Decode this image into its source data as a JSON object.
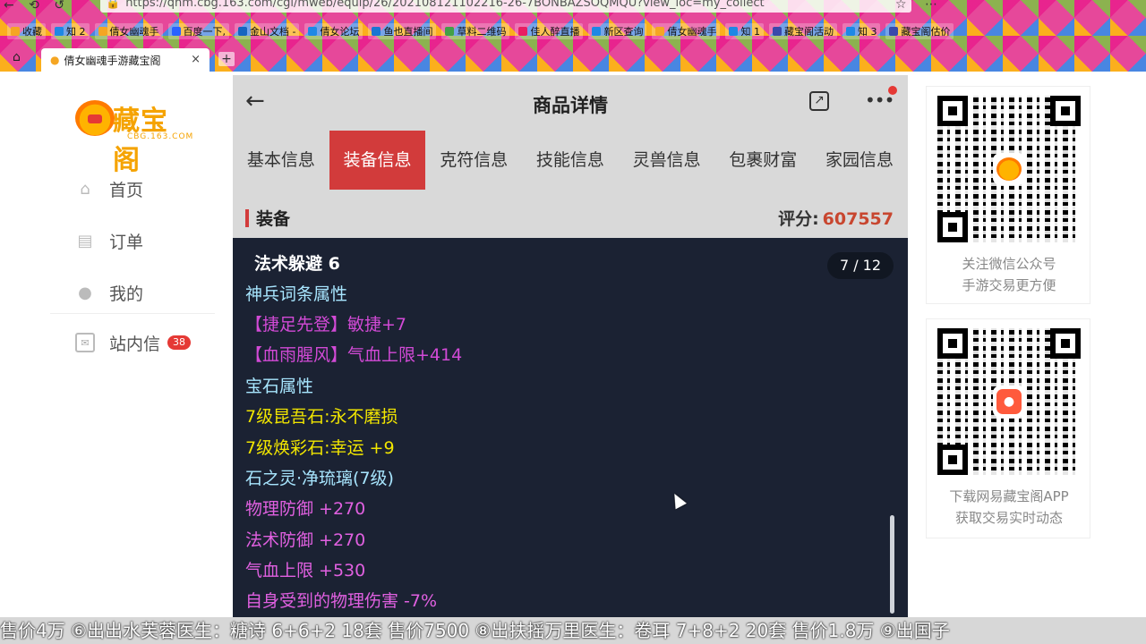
{
  "browser": {
    "url": "https://qnm.cbg.163.com/cgi/mweb/equip/26/202108121102216-26-7BONBAZSOQMQU?view_loc=my_collect",
    "bookmarks": [
      "收藏",
      "知 2",
      "倩女幽魂手",
      "百度一下,",
      "金山文档 -",
      "倩女论坛",
      "鱼也直播间",
      "草料二维码",
      "佳人醉直播",
      "新区查询",
      "倩女幽魂手",
      "知 1",
      "藏宝阁活动",
      "知 3",
      "藏宝阁估价"
    ],
    "tab_title": "倩女幽魂手游藏宝阁",
    "tab_close": "×",
    "new_tab": "+"
  },
  "sidebar": {
    "logo_text": "藏宝阁",
    "logo_sub": "CBG.163.COM",
    "items": [
      {
        "label": "首页",
        "icon": "home-icon"
      },
      {
        "label": "订单",
        "icon": "order-icon"
      },
      {
        "label": "我的",
        "icon": "user-icon"
      }
    ],
    "messages": {
      "label": "站内信",
      "count": "38"
    }
  },
  "detail": {
    "back": "←",
    "title": "商品详情",
    "tabs": [
      "基本信息",
      "装备信息",
      "克符信息",
      "技能信息",
      "灵兽信息",
      "包裹财富",
      "家园信息"
    ],
    "active_tab": 1,
    "section_title": "装备",
    "score_label": "评分:",
    "score_value": "607557",
    "pager": "7 / 12",
    "attributes": [
      {
        "text": "法术躲避 6",
        "color": "#ffffff",
        "bold": true
      },
      {
        "text": "神兵词条属性",
        "color": "#a8e6ff"
      },
      {
        "text": "【捷足先登】敏捷+7",
        "color": "#d24ad6"
      },
      {
        "text": "【血雨腥风】气血上限+414",
        "color": "#d24ad6"
      },
      {
        "text": "宝石属性",
        "color": "#a8e6ff"
      },
      {
        "text": "7级昆吾石:永不磨损",
        "color": "#f2e600"
      },
      {
        "text": "7级焕彩石:幸运 +9",
        "color": "#f2e600"
      },
      {
        "text": "石之灵·净琉璃(7级)",
        "color": "#a8e6ff"
      },
      {
        "text": "物理防御 +270",
        "color": "#e060e0"
      },
      {
        "text": "法术防御 +270",
        "color": "#e060e0"
      },
      {
        "text": "气血上限 +530",
        "color": "#e060e0"
      },
      {
        "text": "自身受到的物理伤害 -7%",
        "color": "#e060e0"
      }
    ]
  },
  "qr_cards": [
    {
      "line1": "关注微信公众号",
      "line2": "手游交易更方便"
    },
    {
      "line1": "下载网易藏宝阁APP",
      "line2": "获取交易实时动态"
    }
  ],
  "ticker": "售价4万 ⑥出出水芙蓉医生：糖诗 6+6+2 18套 售价7500 ⑧出扶摇万里医生：卷耳 7+8+2 20套 售价1.8万 ⑨出国子"
}
